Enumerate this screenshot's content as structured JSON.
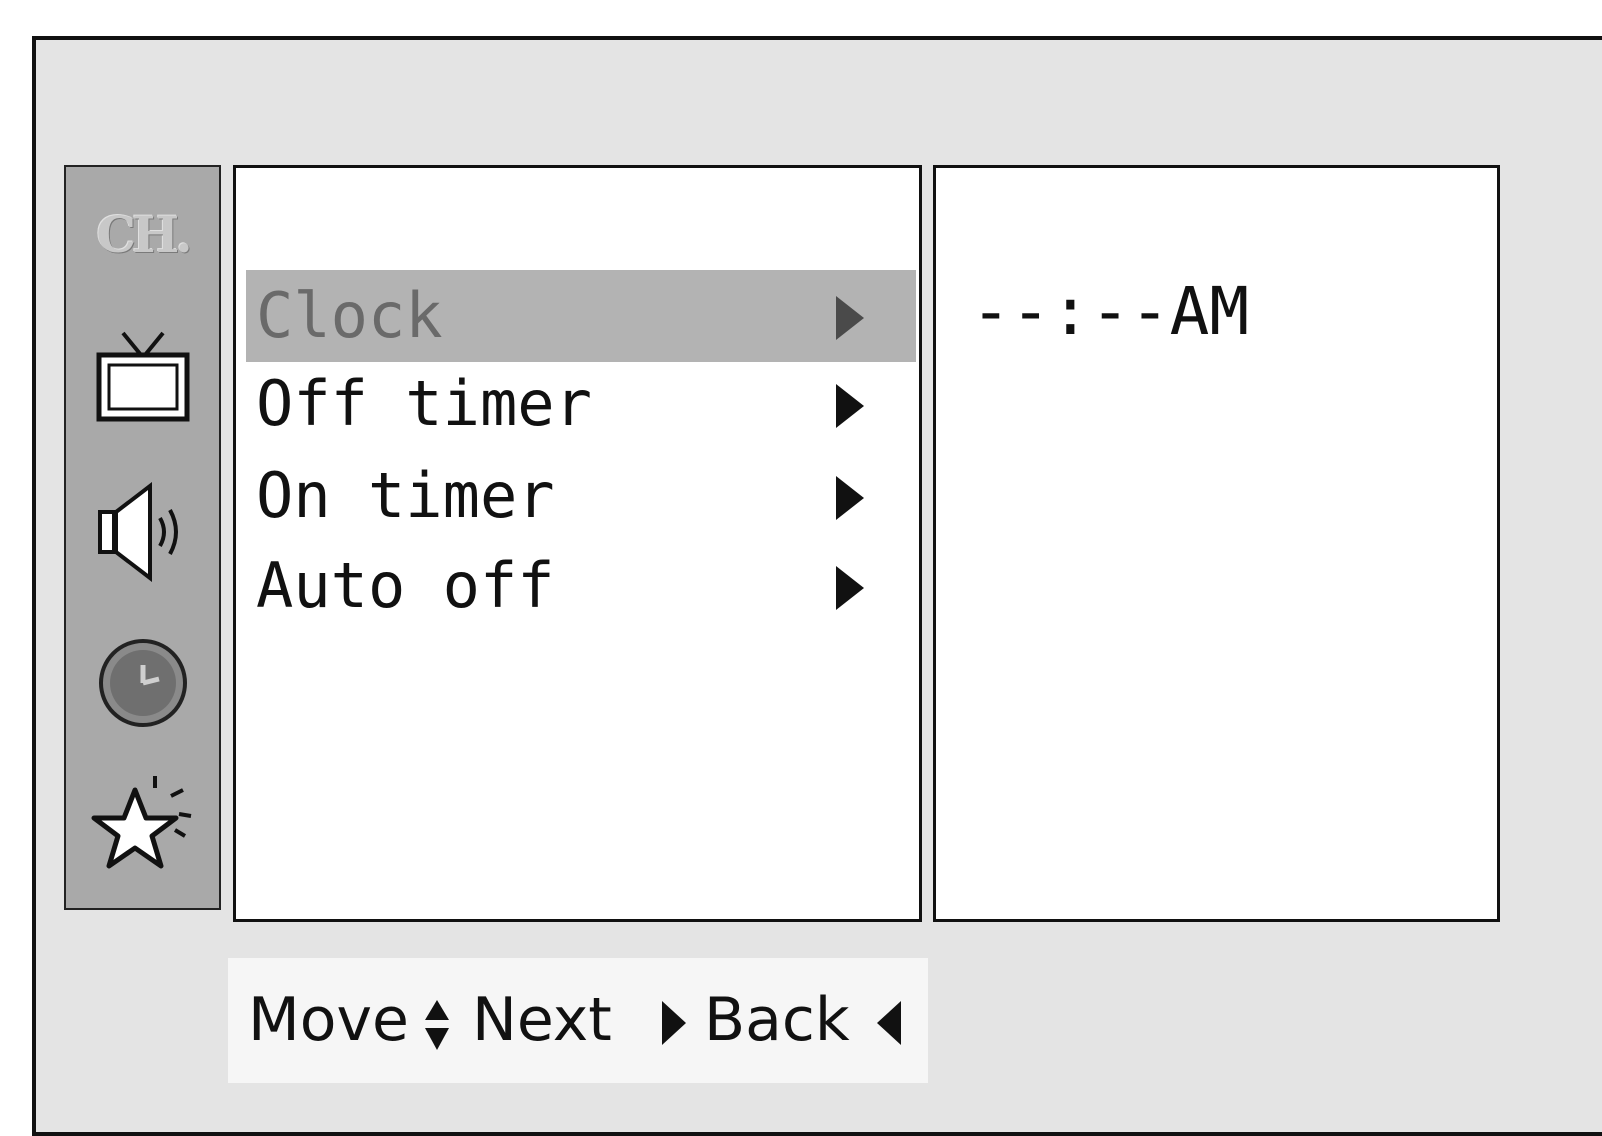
{
  "sidebar": {
    "items": [
      {
        "label": "CH.",
        "icon": "channel-icon"
      },
      {
        "icon": "tv-picture-icon"
      },
      {
        "icon": "speaker-audio-icon"
      },
      {
        "icon": "clock-time-icon"
      },
      {
        "icon": "star-special-icon"
      }
    ]
  },
  "menu": {
    "items": [
      {
        "label": "Clock",
        "selected": true
      },
      {
        "label": "Off timer",
        "selected": false
      },
      {
        "label": "On timer",
        "selected": false
      },
      {
        "label": "Auto off",
        "selected": false
      }
    ]
  },
  "value_panel": {
    "clock_value": "--:--AM"
  },
  "help_bar": {
    "move_label": "Move",
    "next_label": "Next",
    "back_label": "Back"
  },
  "colors": {
    "screen_bg": "#e4e4e4",
    "sidebar_bg": "#a9a9a9",
    "highlight_bg": "#b3b3b3",
    "panel_bg": "#ffffff"
  }
}
